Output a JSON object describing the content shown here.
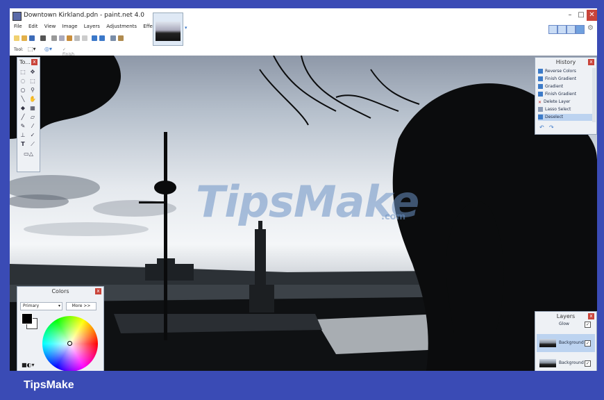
{
  "window": {
    "title": "Downtown Kirkland.pdn - paint.net 4.0",
    "minimize": "–",
    "maximize": "□",
    "close": "✕"
  },
  "menu": [
    "File",
    "Edit",
    "View",
    "Image",
    "Layers",
    "Adjustments",
    "Effects"
  ],
  "toolbar_row": {
    "tool_label": "Tool:",
    "finish_label": "Finish"
  },
  "tools_panel": {
    "title": "To..."
  },
  "history_panel": {
    "title": "History",
    "items": [
      {
        "label": "Reverse Colors",
        "icon": "history-icon"
      },
      {
        "label": "Finish Gradient",
        "icon": "history-icon"
      },
      {
        "label": "Gradient",
        "icon": "history-icon"
      },
      {
        "label": "Finish Gradient",
        "icon": "history-icon"
      },
      {
        "label": "Delete Layer",
        "icon": "delete-icon"
      },
      {
        "label": "Lasso Select",
        "icon": "lasso-icon"
      },
      {
        "label": "Deselect",
        "icon": "history-icon",
        "selected": true
      }
    ]
  },
  "colors_panel": {
    "title": "Colors",
    "mode": "Primary",
    "more_button": "More >>"
  },
  "layers_panel": {
    "title": "Layers",
    "layers": [
      {
        "name": "Glow",
        "visible": true
      },
      {
        "name": "Background",
        "visible": true,
        "selected": true
      },
      {
        "name": "Background",
        "visible": true
      }
    ]
  },
  "watermark": {
    "text": "TipsMake",
    "suffix": ".com"
  },
  "footer": {
    "brand": "TipsMake"
  },
  "colors": {
    "accent": "#3a4bb5",
    "selection": "#bcd3f0"
  }
}
